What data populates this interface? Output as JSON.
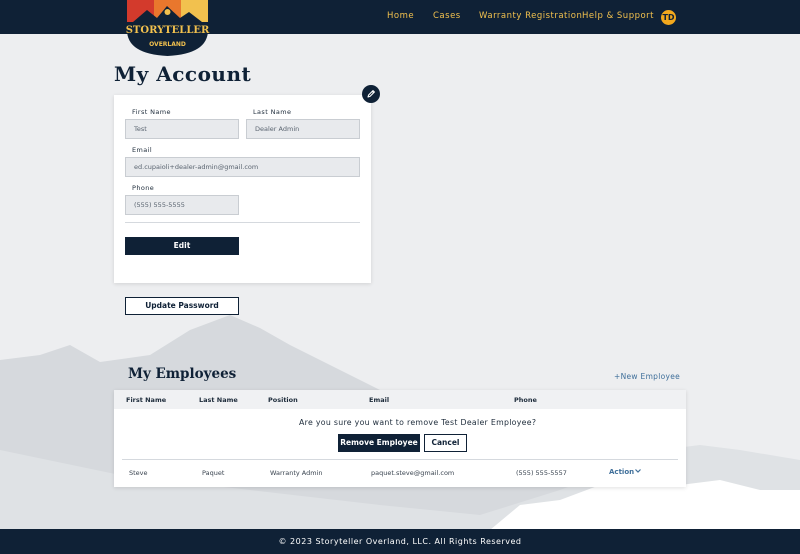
{
  "brand": {
    "name": "STORYTELLER",
    "sub": "OVERLAND",
    "colors": {
      "navy": "#0f2136",
      "gold": "#f2c14e",
      "red": "#d33a2c",
      "link": "#3f6f9a"
    }
  },
  "nav": {
    "items": [
      {
        "label": "Home"
      },
      {
        "label": "Cases"
      },
      {
        "label": "Warranty Registration"
      },
      {
        "label": "Help & Support"
      }
    ],
    "avatar_initials": "TD"
  },
  "account": {
    "title": "My Account",
    "first_name_label": "First Name",
    "first_name_value": "Test",
    "last_name_label": "Last Name",
    "last_name_value": "Dealer Admin",
    "email_label": "Email",
    "email_value": "ed.cupaioli+dealer-admin@gmail.com",
    "phone_label": "Phone",
    "phone_value": "(555) 555-5555",
    "edit_label": "Edit",
    "update_password_label": "Update Password",
    "pencil_icon": "pencil-icon"
  },
  "employees": {
    "title": "My Employees",
    "new_label": "+New Employee",
    "columns": [
      "First Name",
      "Last Name",
      "Position",
      "Email",
      "Phone"
    ],
    "confirm_text": "Are you sure you want to remove Test Dealer Employee?",
    "remove_label": "Remove Employee",
    "cancel_label": "Cancel",
    "rows": [
      {
        "first": "Steve",
        "last": "Paquet",
        "position": "Warranty Admin",
        "email": "paquet.steve@gmail.com",
        "phone": "(555) 555-5557",
        "action": "Action"
      }
    ]
  },
  "footer": {
    "text": "© 2023 Storyteller Overland, LLC. All Rights Reserved"
  }
}
